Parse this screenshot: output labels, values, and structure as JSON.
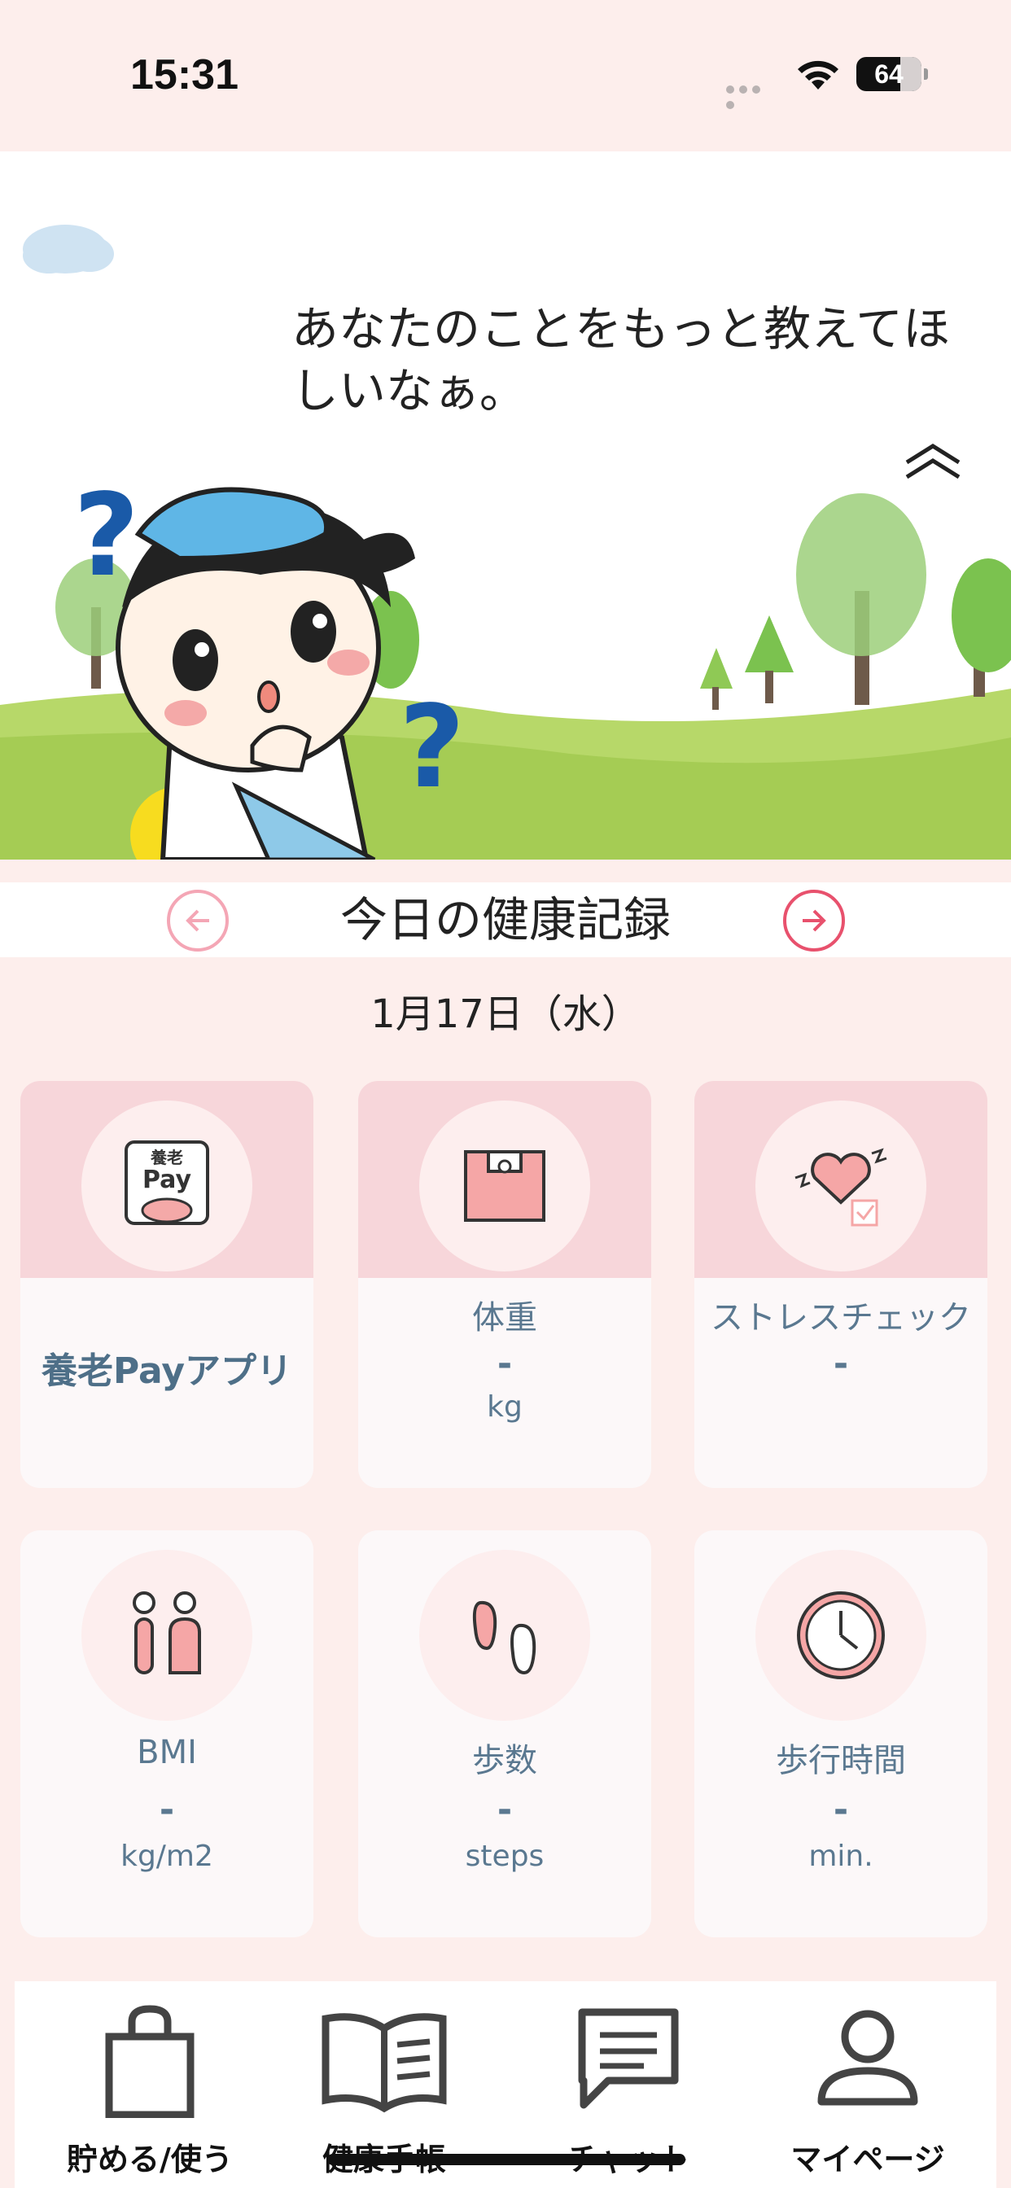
{
  "status_bar": {
    "time": "15:31",
    "battery": "64"
  },
  "hero": {
    "speech": "あなたのことをもっと教えてほしいなぁ。"
  },
  "record": {
    "title": "今日の健康記録",
    "date": "1月17日（水）"
  },
  "cards": [
    {
      "label": "養老Payアプリ",
      "value": "",
      "unit": "",
      "icon": "yoro-pay-icon"
    },
    {
      "label": "体重",
      "value": "-",
      "unit": "kg",
      "icon": "scale-icon"
    },
    {
      "label": "ストレスチェック",
      "value": "-",
      "unit": "",
      "icon": "heart-check-icon"
    },
    {
      "label": "BMI",
      "value": "-",
      "unit": "kg/m2",
      "icon": "people-icon"
    },
    {
      "label": "歩数",
      "value": "-",
      "unit": "steps",
      "icon": "footprints-icon"
    },
    {
      "label": "歩行時間",
      "value": "-",
      "unit": "min.",
      "icon": "clock-icon"
    }
  ],
  "pay_icon_text": {
    "top": "養老",
    "bottom": "Pay"
  },
  "tabs": [
    {
      "label": "貯める/使う",
      "icon": "shopping-bag-icon"
    },
    {
      "label": "健康手帳",
      "icon": "book-icon"
    },
    {
      "label": "チャット",
      "icon": "chat-icon"
    },
    {
      "label": "マイページ",
      "icon": "person-icon"
    }
  ],
  "colors": {
    "background": "#fdeeec",
    "card_band": "#f7d6da",
    "card_text": "#5a7890",
    "accent_pink": "#e8516d"
  }
}
